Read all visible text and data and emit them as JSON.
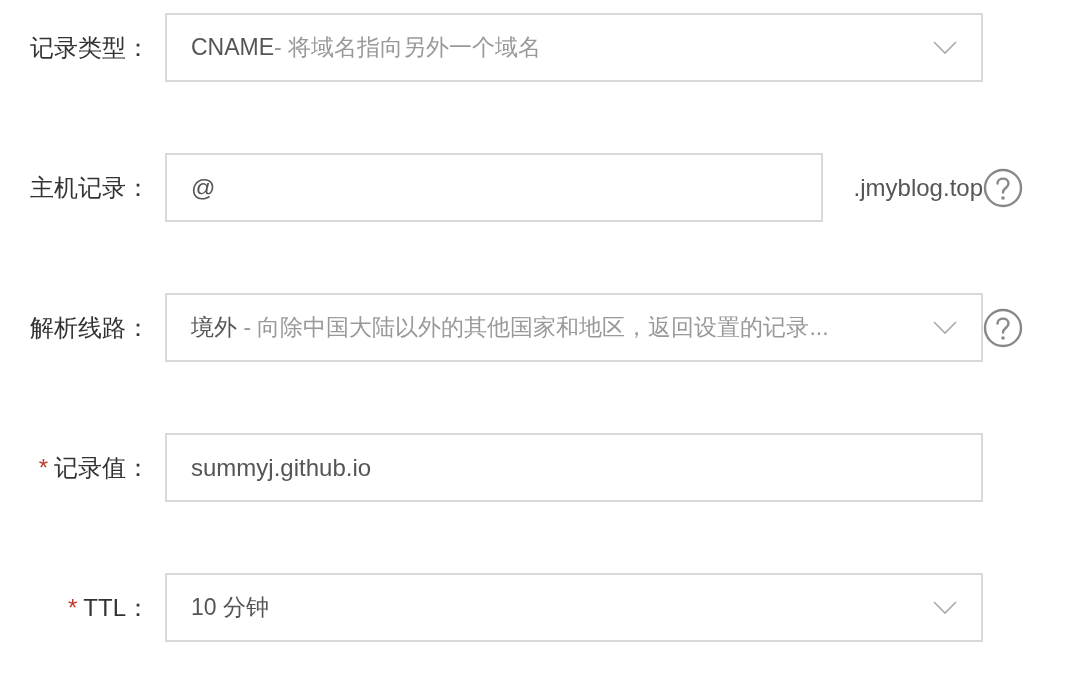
{
  "fields": [
    {
      "kind": "select",
      "label": "记录类型：",
      "value": "CNAME",
      "hint": "- 将域名指向另外一个域名"
    },
    {
      "kind": "input",
      "label": "主机记录：",
      "value": "@",
      "suffix": ".jmyblog.top",
      "help": true
    },
    {
      "kind": "select",
      "label": "解析线路：",
      "value": "境外",
      "hint": " - 向除中国大陆以外的其他国家和地区，返回设置的记录...",
      "help": true
    },
    {
      "kind": "input",
      "label": "记录值：",
      "required_mark": "*",
      "value": "summyj.github.io"
    },
    {
      "kind": "select",
      "label": "TTL：",
      "required_mark": "*",
      "value": "10 分钟"
    }
  ]
}
